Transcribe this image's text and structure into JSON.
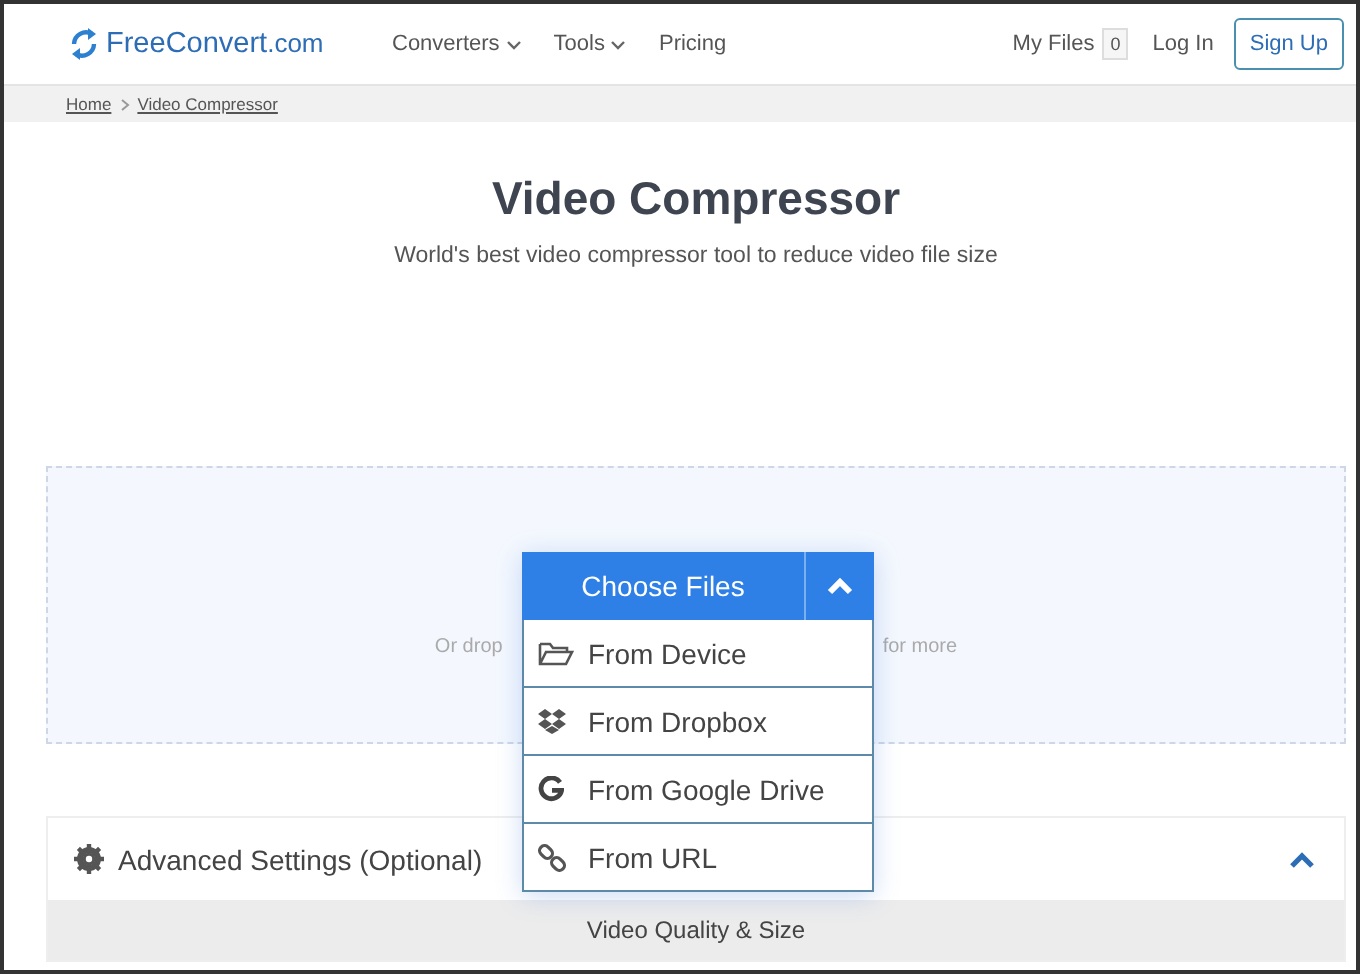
{
  "header": {
    "logo": "FreeConvert",
    "logo_suffix": ".com",
    "nav": [
      {
        "label": "Converters",
        "dropdown": true
      },
      {
        "label": "Tools",
        "dropdown": true
      },
      {
        "label": "Pricing",
        "dropdown": false
      }
    ],
    "my_files": "My Files",
    "files_count": "0",
    "login": "Log In",
    "signup": "Sign Up"
  },
  "breadcrumb": [
    {
      "label": "Home"
    },
    {
      "label": "Video Compressor"
    }
  ],
  "title": "Video Compressor",
  "subtitle": "World's best video compressor tool to reduce video file size",
  "dropzone": {
    "text_left": "Or drop",
    "text_right": "for more"
  },
  "choose_button": {
    "label": "Choose Files",
    "expanded": true
  },
  "menu": [
    {
      "label": "From Device"
    },
    {
      "label": "From Dropbox"
    },
    {
      "label": "From Google Drive"
    },
    {
      "label": "From URL"
    }
  ],
  "advanced": {
    "label": "Advanced Settings (Optional)",
    "expanded": true,
    "section": "Video Quality & Size"
  }
}
